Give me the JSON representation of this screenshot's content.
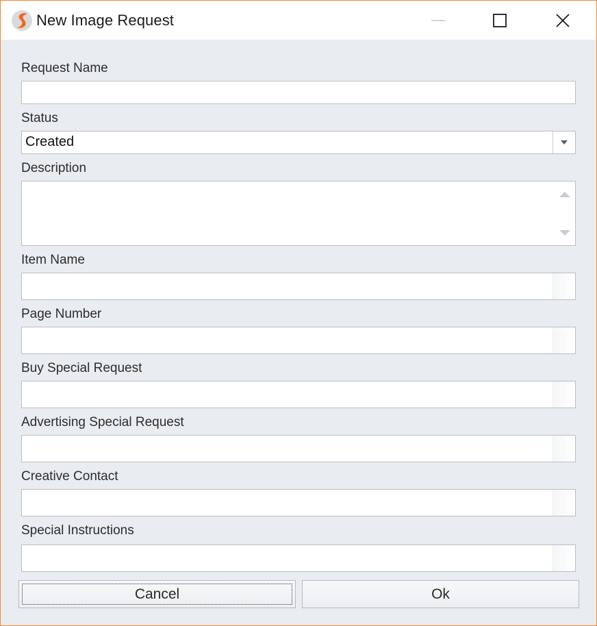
{
  "window": {
    "title": "New Image Request",
    "logo": "app-logo-icon",
    "controls": [
      "minimize-icon",
      "maximize-icon",
      "close-icon"
    ]
  },
  "form": {
    "request_name": {
      "label": "Request Name",
      "value": ""
    },
    "status": {
      "label": "Status",
      "value": "Created",
      "icon": "chevron-down-icon"
    },
    "description": {
      "label": "Description",
      "value": ""
    },
    "item_name": {
      "label": "Item Name",
      "value": ""
    },
    "page_number": {
      "label": "Page Number",
      "value": ""
    },
    "buy_special_request": {
      "label": "Buy Special Request",
      "value": ""
    },
    "advertising_special_request": {
      "label": "Advertising Special Request",
      "value": ""
    },
    "creative_contact": {
      "label": "Creative Contact",
      "value": ""
    },
    "special_instructions": {
      "label": "Special Instructions",
      "value": ""
    }
  },
  "buttons": {
    "cancel": "Cancel",
    "ok": "Ok"
  },
  "colors": {
    "window_border": "#f0862e",
    "background": "#e9ecf0",
    "titlebar": "#ffffff"
  }
}
